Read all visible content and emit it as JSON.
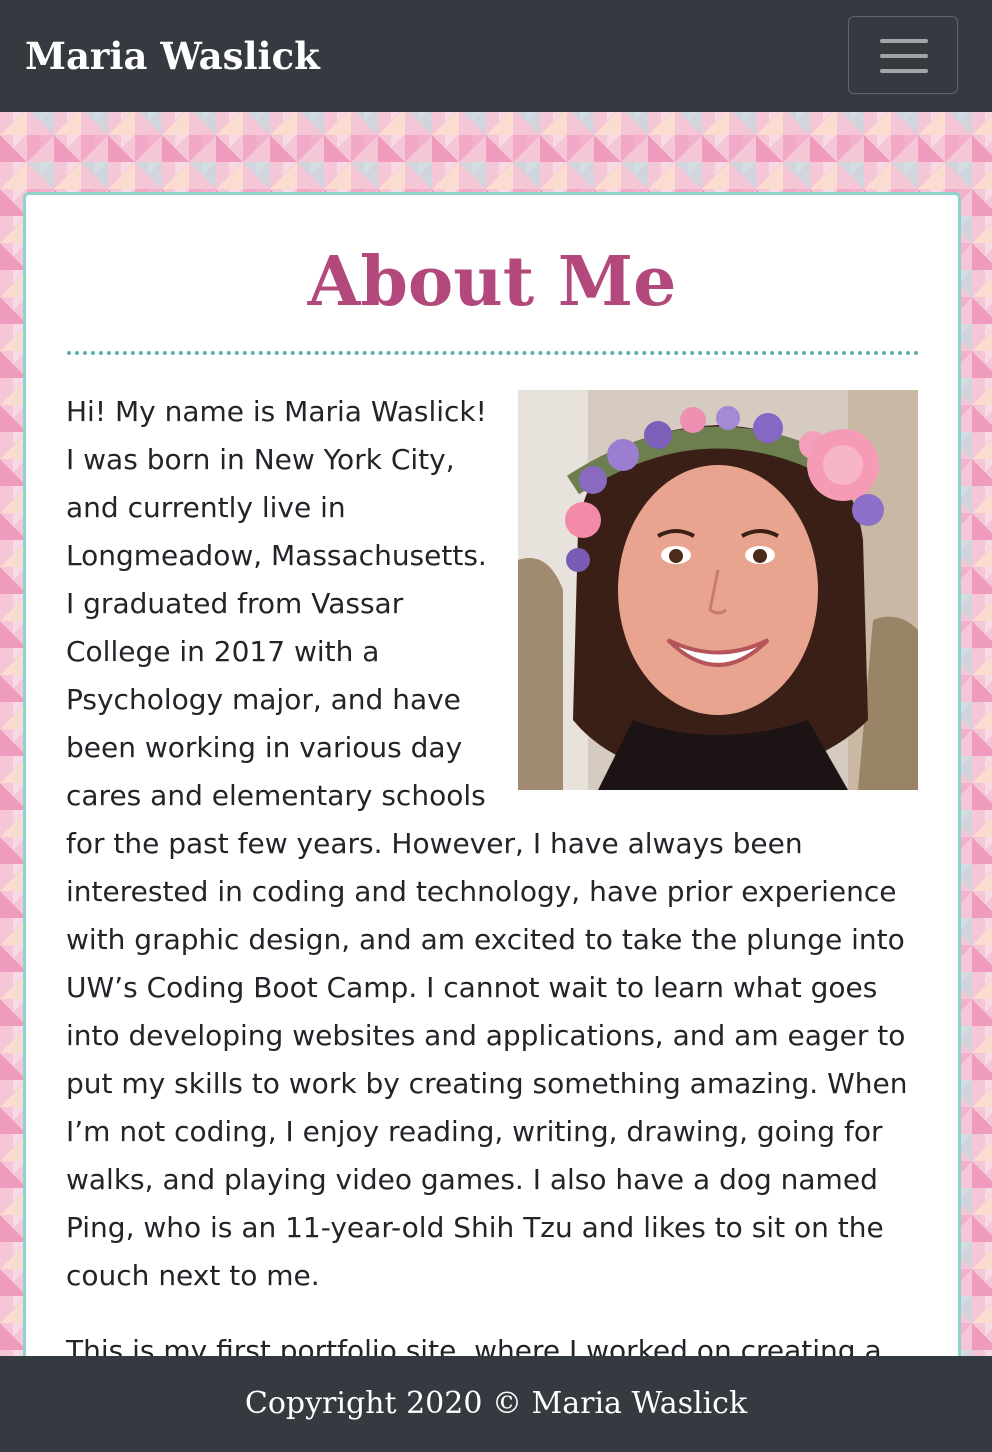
{
  "navbar": {
    "brand": "Maria Waslick",
    "toggler_icon": "hamburger-menu-icon"
  },
  "about": {
    "heading": "About Me",
    "photo_alt": "Maria Waslick",
    "paragraph_1": "Hi! My name is Maria Waslick! I was born in New York City, and currently live in Longmeadow, Massachusetts. I graduated from Vassar College in 2017 with a Psychology major, and have been working in various day cares and elementary schools for the past few years. However, I have always been interested in coding and technology, have prior experience with graphic design, and am excited to take the plunge into UW’s Coding Boot Camp. I cannot wait to learn what goes into developing websites and applications, and am eager to put my skills to work by creating something amazing. When I’m not coding, I enjoy reading, writing, drawing, going for walks, and playing video games. I also have a dog named Ping, who is an 11-year-old Shih Tzu and likes to sit on the couch next to me.",
    "paragraph_2": "This is my first portfolio site, where I worked on creating a"
  },
  "footer": {
    "copyright": "Copyright 2020 © Maria Waslick"
  },
  "colors": {
    "navbar_bg": "#343a40",
    "heading": "#b3487c",
    "card_border": "#8fd3cc",
    "divider": "#5fb3a8"
  }
}
